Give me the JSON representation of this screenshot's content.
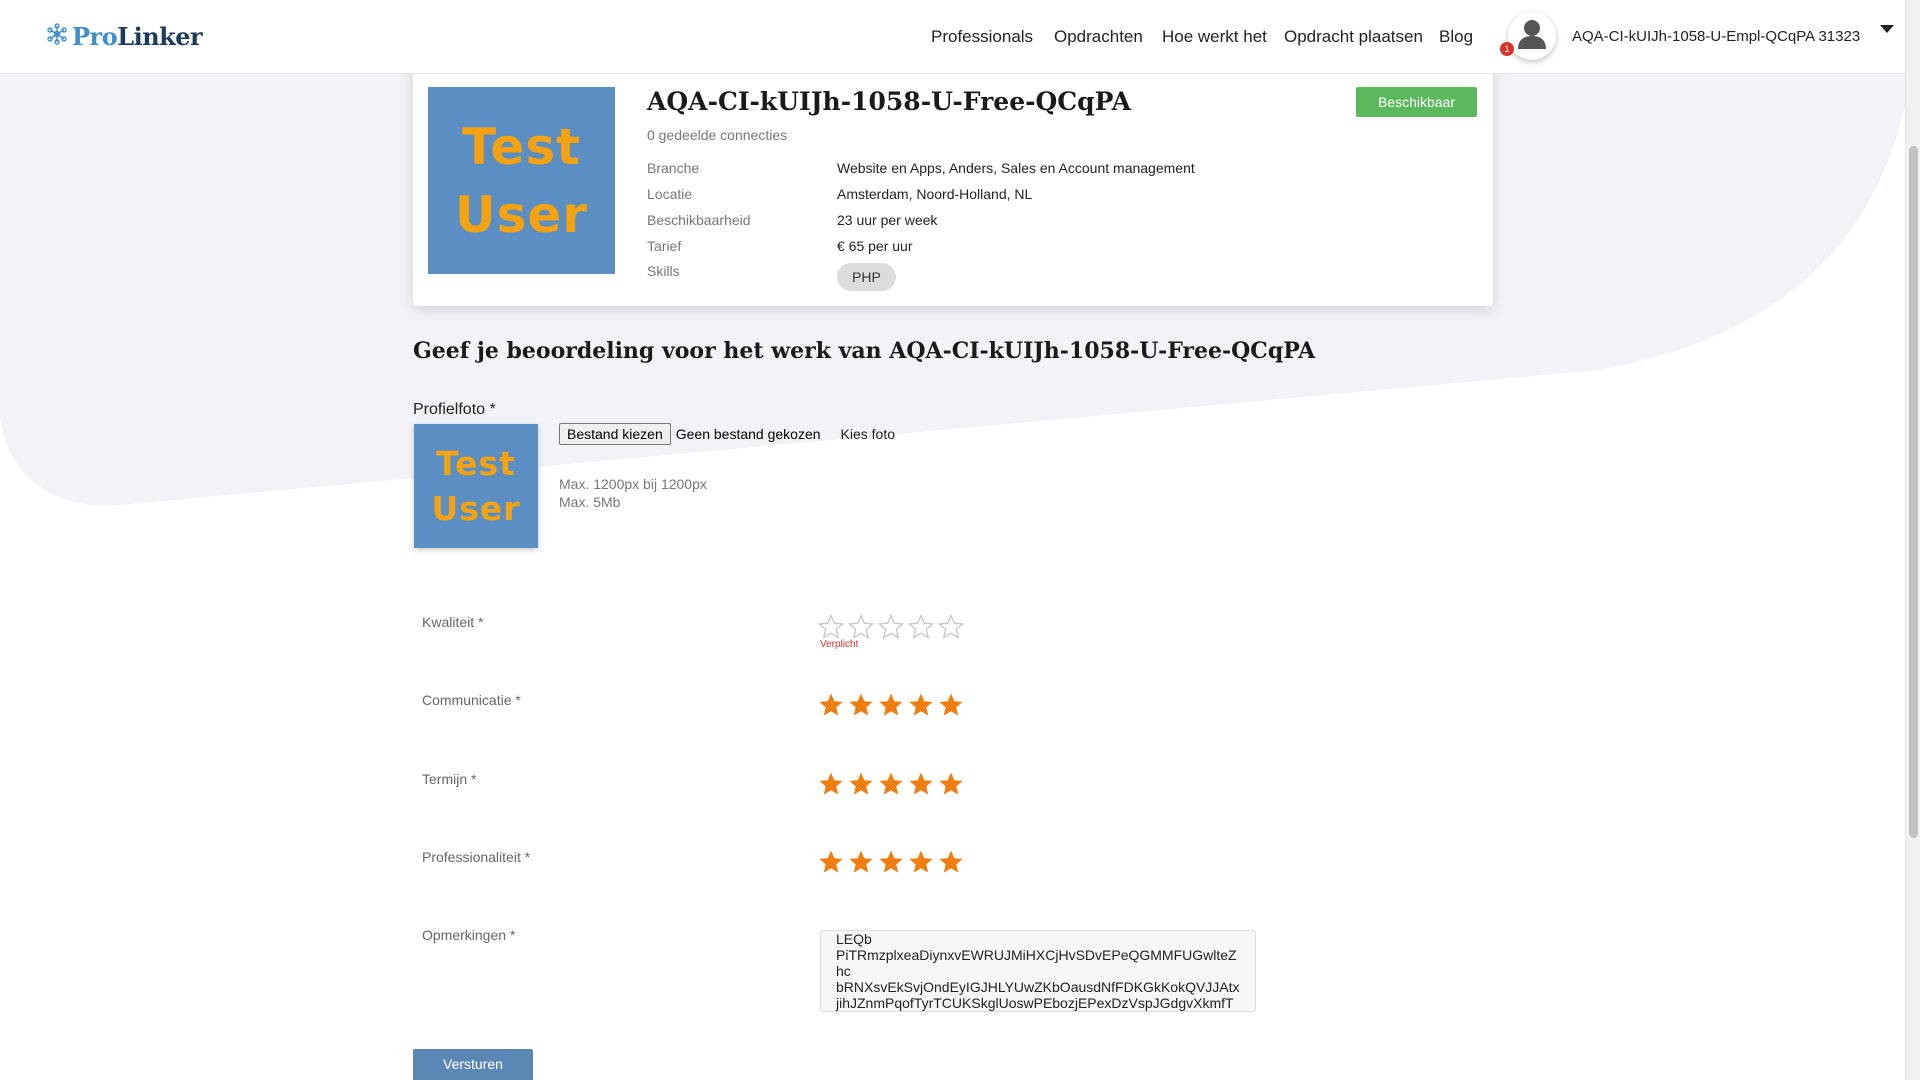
{
  "header": {
    "logo_pro": "Pro",
    "logo_linker": "Linker",
    "nav": [
      "Professionals",
      "Opdrachten",
      "Hoe werkt het",
      "Opdracht plaatsen",
      "Blog"
    ],
    "notification_count": "1",
    "user_name": "AQA-CI-kUIJh-1058-U-Empl-QCqPA 31323"
  },
  "profile": {
    "photo_text_line1": "Test",
    "photo_text_line2": "User",
    "name": "AQA-CI-kUIJh-1058-U-Free-QCqPA",
    "connections": "0 gedeelde connecties",
    "status": "Beschikbaar",
    "details": [
      {
        "label": "Branche",
        "value": "Website en Apps, Anders, Sales en Account management"
      },
      {
        "label": "Locatie",
        "value": "Amsterdam, Noord-Holland, NL"
      },
      {
        "label": "Beschikbaarheid",
        "value": "23 uur per week"
      },
      {
        "label": "Tarief",
        "value": "€ 65 per uur"
      },
      {
        "label": "Skills",
        "value": ""
      }
    ],
    "skills": [
      "PHP"
    ]
  },
  "review": {
    "title": "Geef je beoordeling voor het werk van AQA-CI-kUIJh-1058-U-Free-QCqPA",
    "photo_label": "Profielfoto *",
    "file_button": "Bestand kiezen",
    "file_status": "Geen bestand gekozen",
    "choose_photo": "Kies foto",
    "hint_size": "Max. 1200px bij 1200px",
    "hint_mb": "Max. 5Mb",
    "ratings": [
      {
        "label": "Kwaliteit *",
        "stars": 0,
        "max": 5
      },
      {
        "label": "Communicatie *",
        "stars": 5,
        "max": 5
      },
      {
        "label": "Termijn *",
        "stars": 5,
        "max": 5
      },
      {
        "label": "Professionaliteit *",
        "stars": 5,
        "max": 5
      }
    ],
    "required_msg": "Verplicht",
    "remarks_label": "Opmerkingen *",
    "remarks_value": "LEQb\nPiTRmzplxeaDiynxvEWRUJMiHXCjHvSDvEPeQGMMFUGwlteZhc\nbRNXsvEkSvjOndEyIGJHLYUwZKbOausdNfFDKGkKokQVJJAtxjihJZnmPqofTyrTCUKSkglUoswPEbozjEPexDzVspJGdgvXkmfT",
    "submit": "Versturen"
  },
  "colors": {
    "star_filled": "#f07d10",
    "star_empty": "#c8c8c8",
    "status_green": "#5cb85c",
    "submit_blue": "#5b87b5",
    "photo_bg": "#5b8fc3",
    "photo_text": "#f5a210"
  }
}
